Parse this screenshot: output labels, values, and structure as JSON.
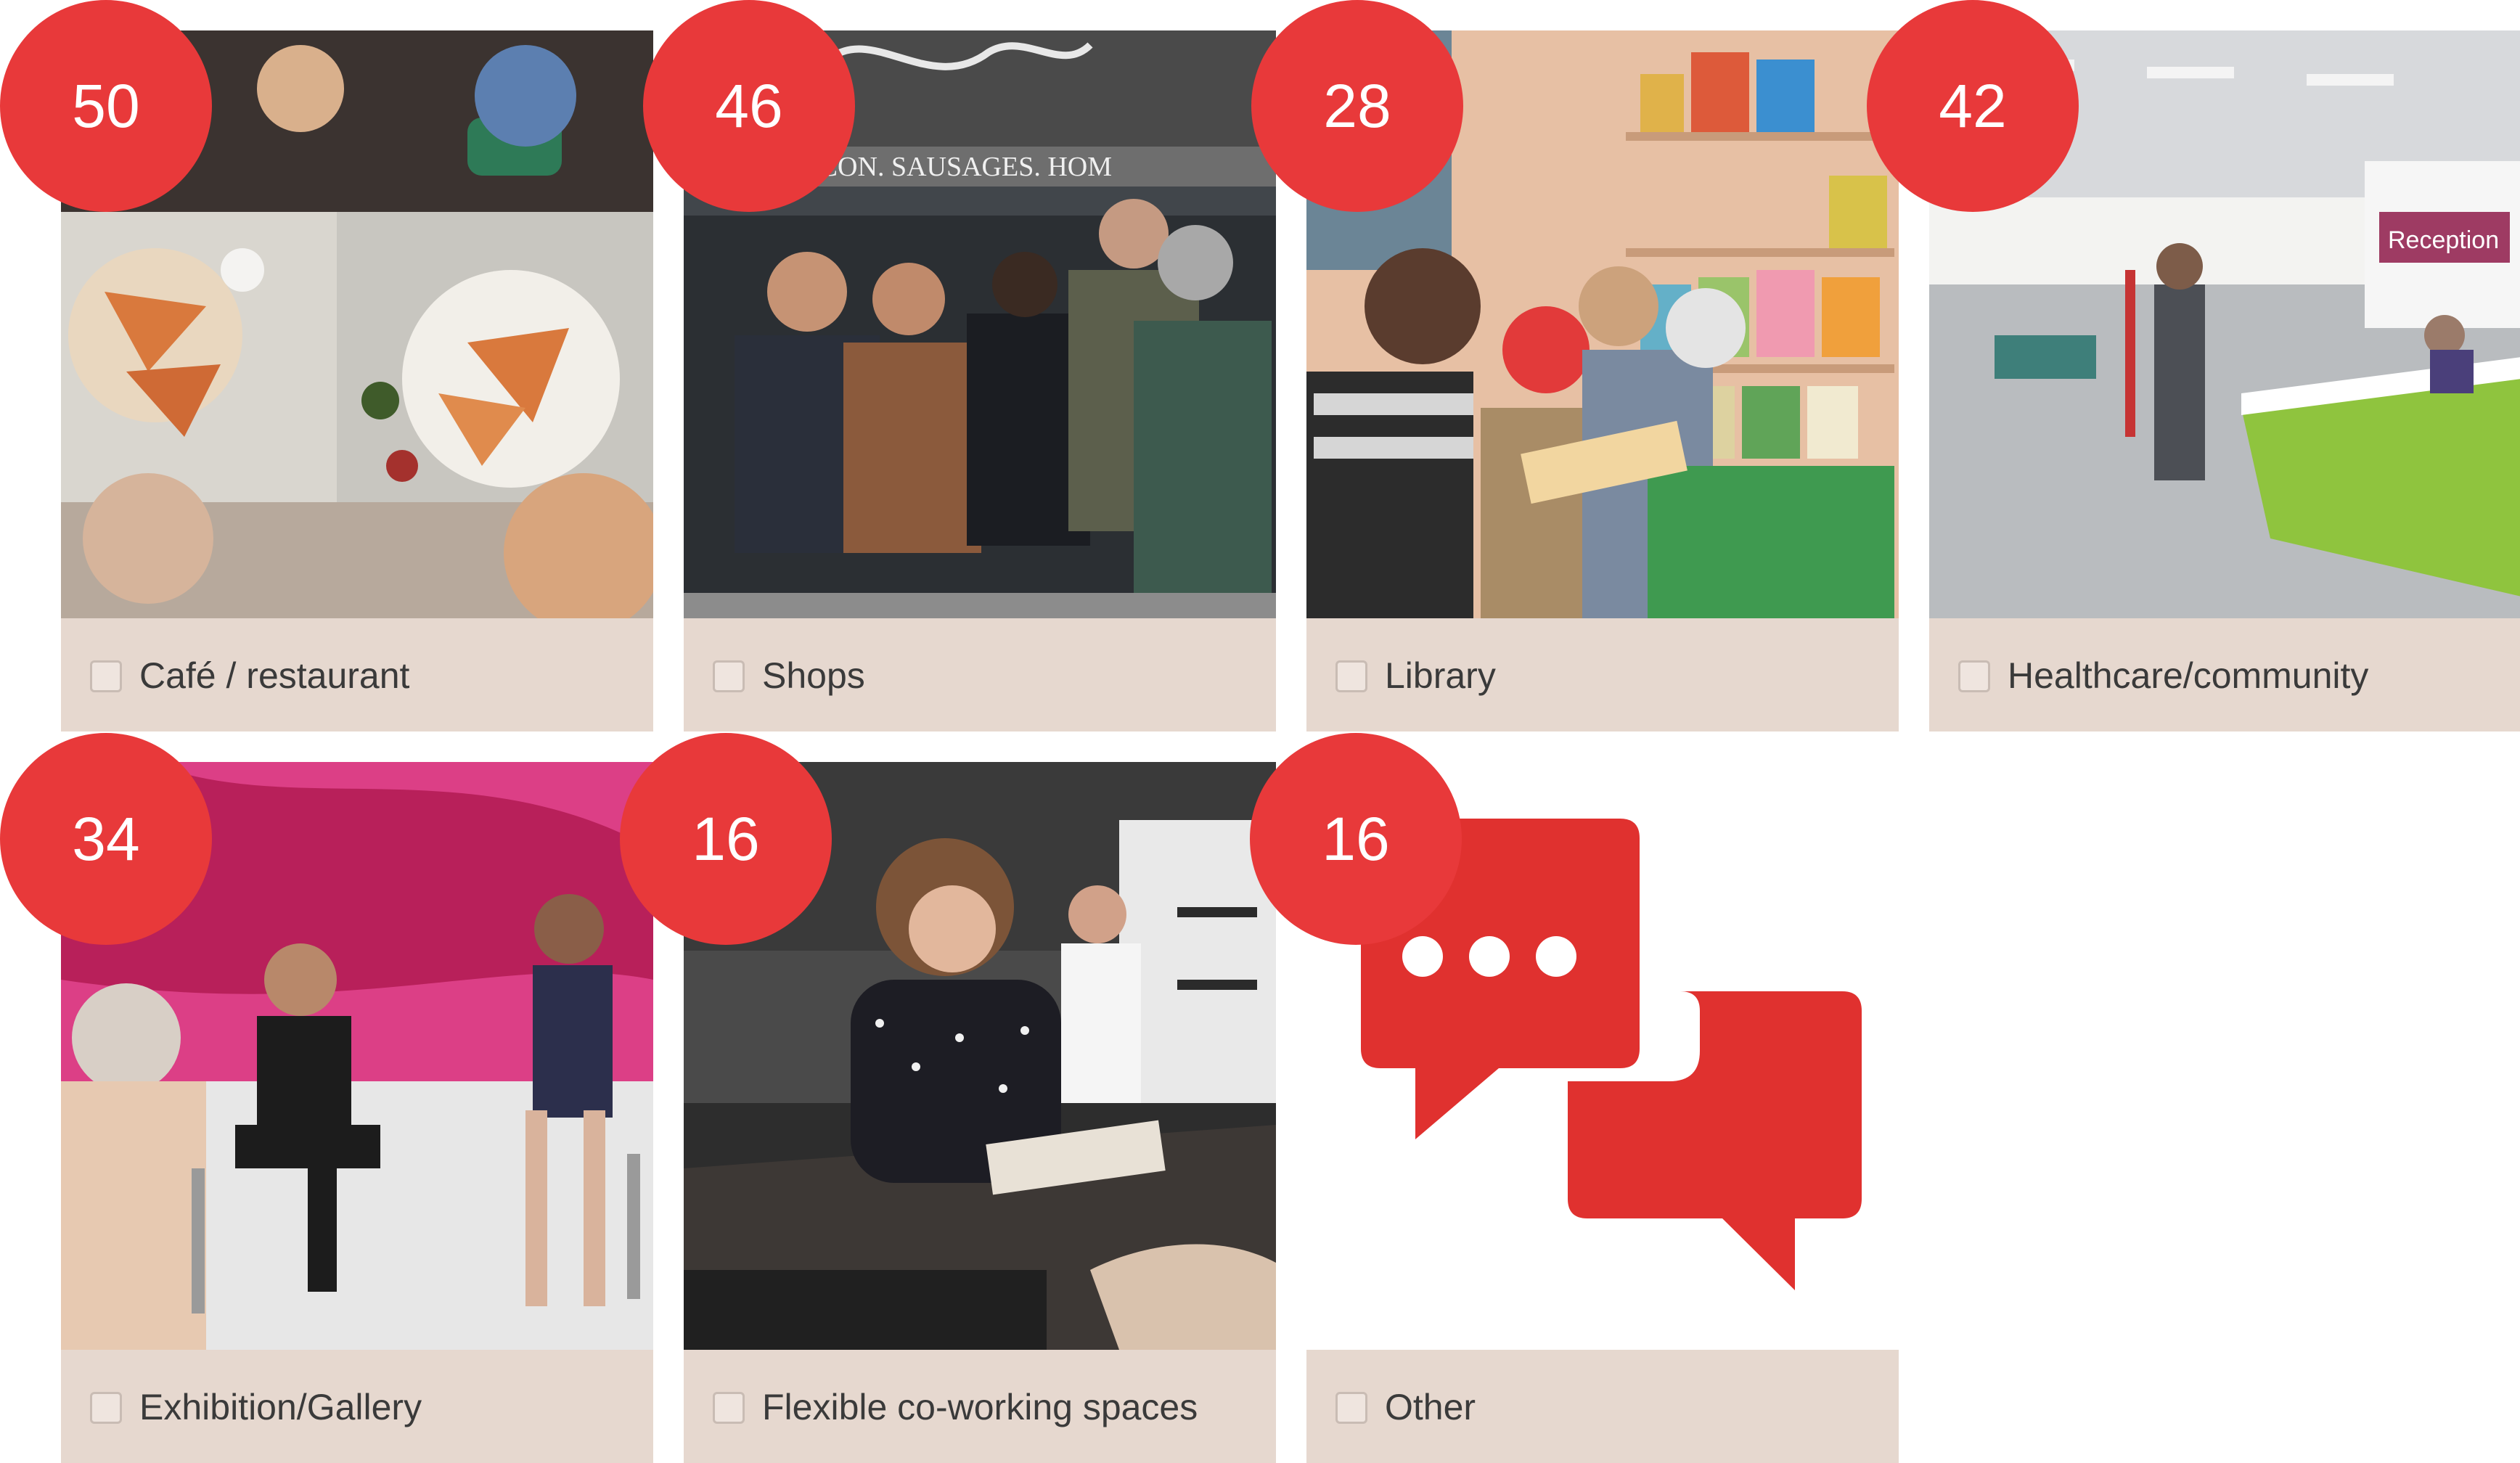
{
  "options": [
    {
      "label": "Café / restaurant",
      "count": "50",
      "checked": false
    },
    {
      "label": "Shops",
      "count": "46",
      "checked": false
    },
    {
      "label": "Library",
      "count": "28",
      "checked": false
    },
    {
      "label": "Healthcare/community",
      "count": "42",
      "checked": false
    },
    {
      "label": "Exhibition/Gallery",
      "count": "34",
      "checked": false
    },
    {
      "label": "Flexible co-working spaces",
      "count": "16",
      "checked": false
    },
    {
      "label": "Other",
      "count": "16",
      "checked": false
    }
  ],
  "photo_texts": {
    "shop_awning": "MS. BACON. SAUSAGES. HOM",
    "reception_sign": "Reception"
  },
  "colors": {
    "badge": "#e8393a",
    "caption_bg": "#e6d8cf",
    "other_icon": "#e0312f"
  },
  "icons": {
    "other": "chat-bubbles-icon"
  }
}
